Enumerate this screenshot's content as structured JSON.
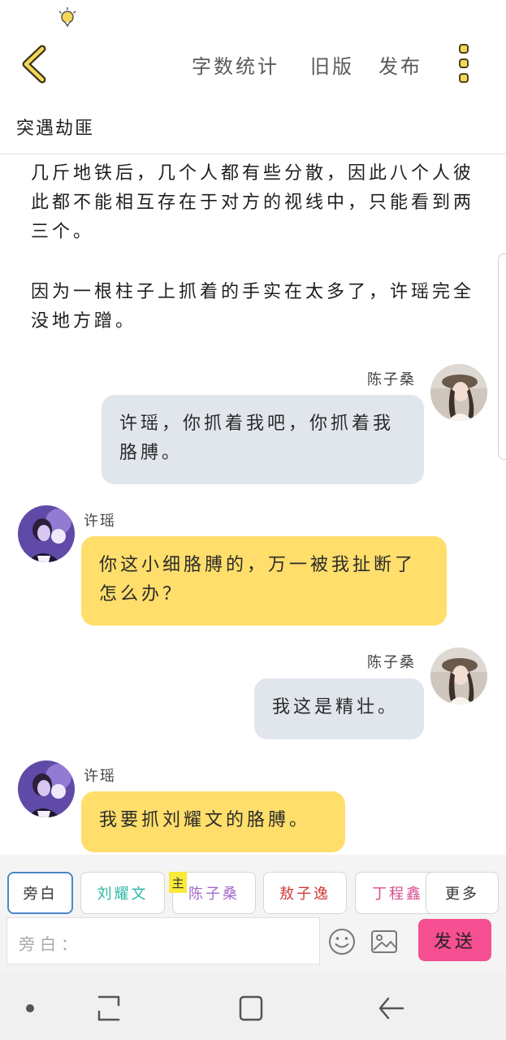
{
  "top_bar": {
    "word_count_label": "字数统计",
    "old_version_label": "旧版",
    "publish_label": "发布"
  },
  "story": {
    "title": "突遇劫匪"
  },
  "narration": [
    "几斤地铁后，几个人都有些分散，因此八个人彼此都不能相互存在于对方的视线中，只能看到两三个。",
    "因为一根柱子上抓着的手实在太多了，许瑶完全没地方蹭。"
  ],
  "messages": [
    {
      "speaker": "陈子桑",
      "side": "right",
      "text": "许瑶，你抓着我吧，你抓着我胳膊。"
    },
    {
      "speaker": "许瑶",
      "side": "left",
      "text": "你这小细胳膊的，万一被我扯断了怎么办？"
    },
    {
      "speaker": "陈子桑",
      "side": "right",
      "text": "我这是精壮。"
    },
    {
      "speaker": "许瑶",
      "side": "left",
      "text": "我要抓刘耀文的胳膊。"
    }
  ],
  "roles": [
    {
      "label": "旁白",
      "color": "#333333"
    },
    {
      "label": "刘耀文",
      "color": "#2bb7a6"
    },
    {
      "label": "陈子桑",
      "color": "#a56bc9"
    },
    {
      "label": "敖子逸",
      "color": "#d23a3a"
    },
    {
      "label": "丁程鑫",
      "color": "#d94d8f"
    },
    {
      "label": "更多",
      "color": "#333333"
    }
  ],
  "main_badge": "主",
  "composer": {
    "input_placeholder": "旁白：",
    "send_label": "发送"
  },
  "colors": {
    "accent_yellow": "#f6d65a",
    "left_bubble": "#ffde6b",
    "right_bubble": "#e1e6ed",
    "send_button": "#f64f92"
  },
  "icons": [
    "lightbulb-icon",
    "back-arrow-icon",
    "more-dots-icon",
    "emoji-icon",
    "image-icon",
    "nav-dot-icon",
    "recent-apps-icon",
    "home-icon",
    "nav-back-icon"
  ]
}
